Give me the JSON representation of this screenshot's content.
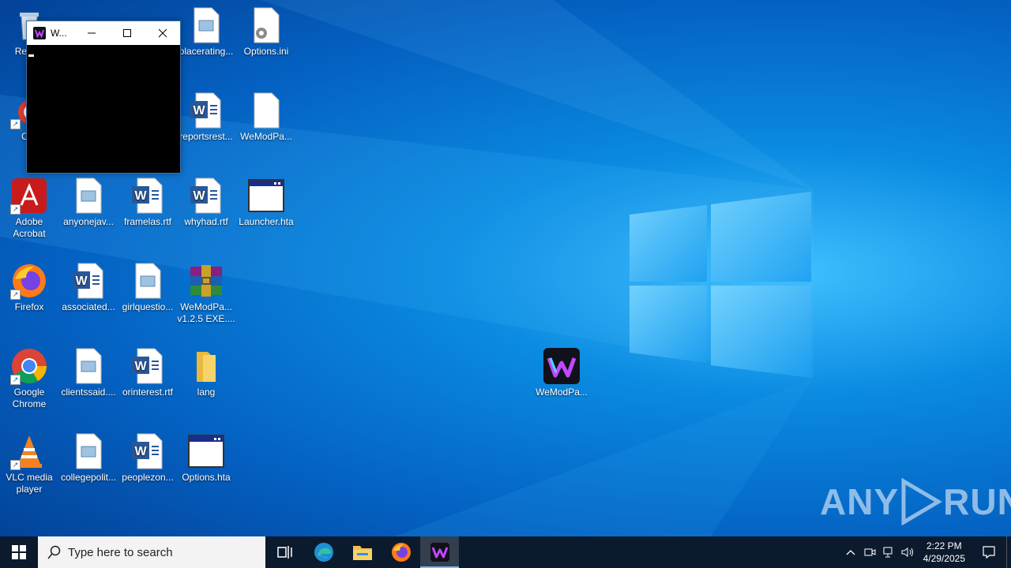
{
  "desktop": {
    "icons": {
      "recycle_bin": "Recy...",
      "ccleaner": "CCl",
      "adobe_acrobat": "Adobe Acrobat",
      "firefox": "Firefox",
      "google_chrome": "Google Chrome",
      "vlc": "VLC media player",
      "placerating": "placerating...",
      "options_ini": "Options.ini",
      "reportsrest": "reportsrest...",
      "wemodpa_file": "WeModPa...",
      "anyonejav": "anyonejav...",
      "framelas": "framelas.rtf",
      "whyhad": "whyhad.rtf",
      "launcher_hta": "Launcher.hta",
      "associated": "associated...",
      "girlquestio": "girlquestio...",
      "wemodpa_rar": "WeModPa... v1.2.5 EXE....",
      "clientssaid": "clientssaid....",
      "orinterest": "orinterest.rtf",
      "lang": "lang",
      "collegepolit": "collegepolit...",
      "peoplezon": "peoplezon...",
      "options_hta": "Options.hta",
      "wemodpa_exe": "WeModPa..."
    }
  },
  "console_window": {
    "title": "W...",
    "icon": "wemod-app-icon",
    "buttons": [
      "minimize-icon",
      "maximize-icon",
      "close-icon"
    ]
  },
  "taskbar": {
    "search_placeholder": "Type here to search",
    "pinned": [
      "task-view-icon",
      "edge-icon",
      "file-explorer-icon",
      "firefox-icon",
      "wemod-icon"
    ],
    "clock_time": "2:22 PM",
    "clock_date": "4/29/2025"
  },
  "watermark": {
    "text_left": "ANY",
    "text_right": "RUN"
  },
  "colors": {
    "taskbar": "#0c1a2e",
    "accent": "#7ab8f5",
    "wallpaper_center": "#3fc0ff"
  }
}
